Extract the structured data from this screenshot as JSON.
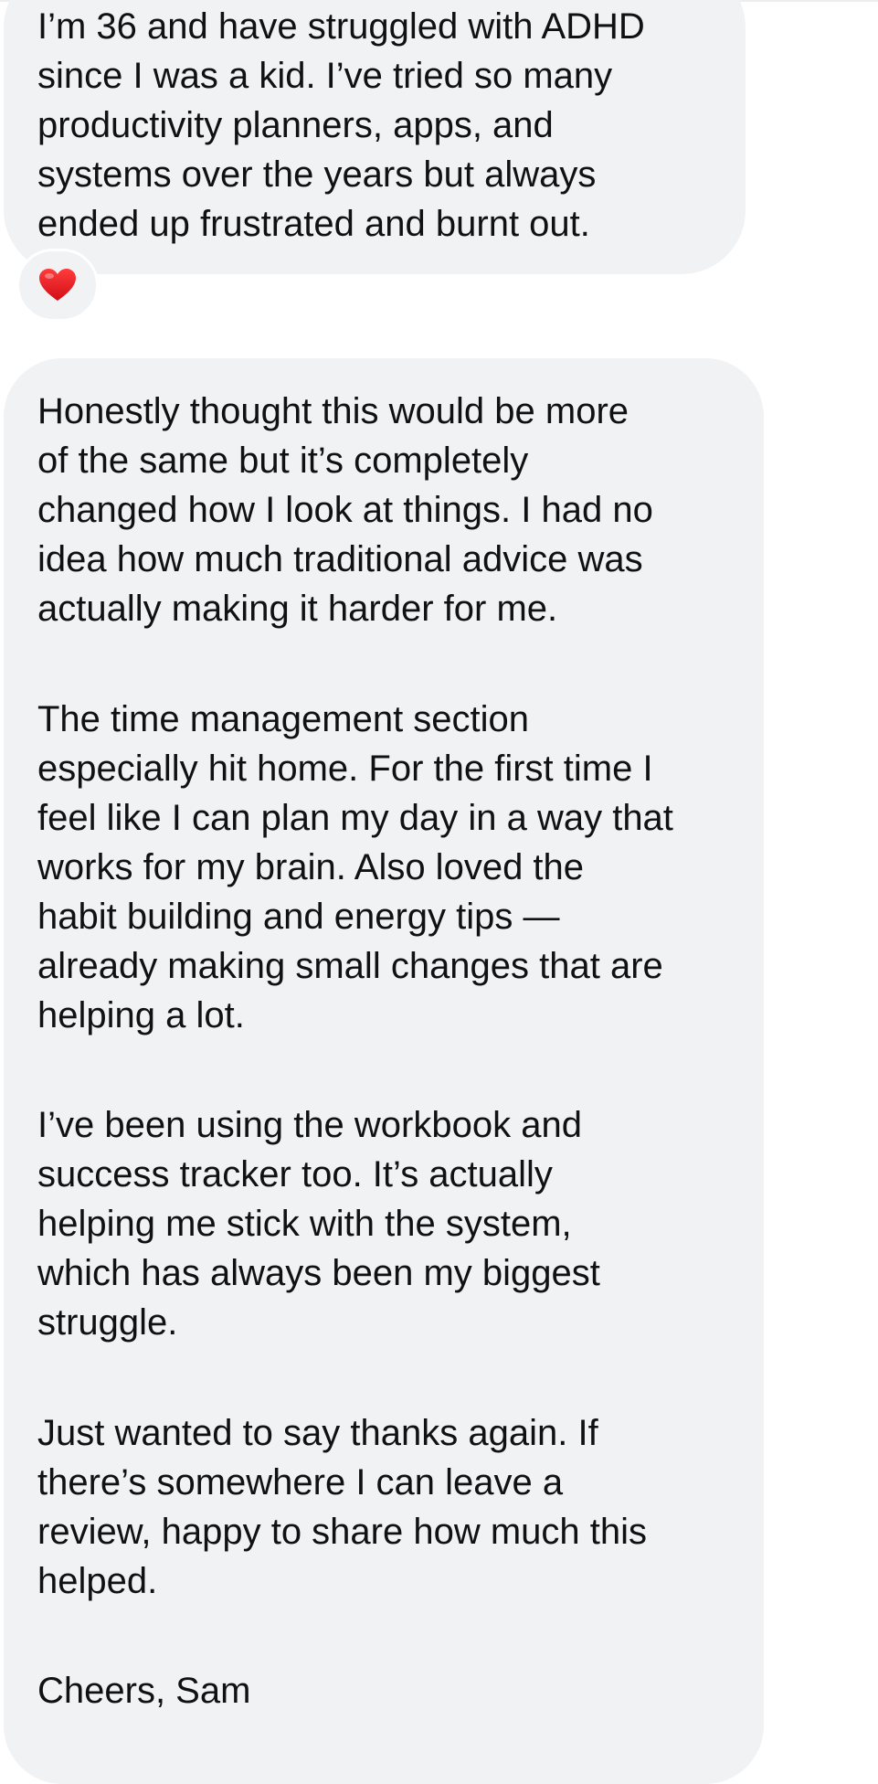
{
  "conversation": {
    "messages": [
      {
        "text": "I’m 36 and have struggled with ADHD\nsince I was a kid. I’ve tried so many\nproductivity planners, apps, and\nsystems over the years but always\nended up frustrated and burnt out.",
        "reaction": {
          "icon": "red-heart-icon",
          "color": "#e0141e"
        }
      },
      {
        "paragraphs": [
          "Honestly thought this would be more\nof the same but it’s completely\nchanged how I look at things. I had no\nidea how much traditional advice was\nactually making it harder for me.",
          "The time management section\nespecially hit home. For the first time I\nfeel like I can plan my day in a way that\nworks for my brain. Also loved the\nhabit building and energy tips —\nalready making small changes that are\nhelping a lot.",
          "I’ve been using the workbook and\nsuccess tracker too. It’s actually\nhelping me stick with the system,\nwhich has always been my biggest\nstruggle.",
          "Just wanted to say thanks again. If\nthere’s somewhere I can leave a\nreview, happy to share how much this\nhelped.",
          "Cheers, Sam"
        ]
      }
    ]
  },
  "colors": {
    "bubble_background": "#f1f2f4",
    "text": "#111111",
    "page_background": "#ffffff"
  }
}
